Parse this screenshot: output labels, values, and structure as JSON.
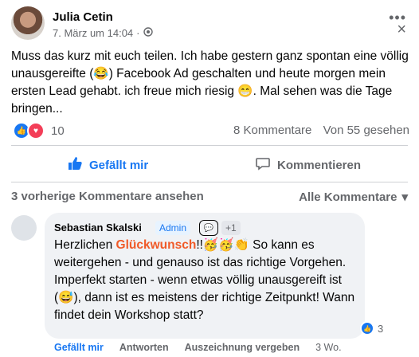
{
  "post": {
    "author": "Julia Cetin",
    "timestamp": "7. März um 14:04",
    "privacy_icon": "group-icon",
    "body": "Muss das kurz mit euch teilen. Ich habe gestern ganz spontan eine völlig unausgereifte (😂) Facebook Ad geschalten und heute morgen mein ersten Lead gehabt. ich freue mich riesig 😁. Mal sehen was die Tage bringen...",
    "reaction_count": "10",
    "comments_count": "8 Kommentare",
    "views": "Von 55 gesehen"
  },
  "actions": {
    "like": "Gefällt mir",
    "comment": "Kommentieren"
  },
  "comments": {
    "previous_label": "3 vorherige Kommentare ansehen",
    "filter_label": "Alle Kommentare"
  },
  "comment": {
    "author": "Sebastian Skalski",
    "role": "Admin",
    "extra_badges": "+1",
    "text_before": "Herzlichen ",
    "highlight": "Glückwunsch",
    "text_after": "!!🥳🥳👏 So kann es weitergehen - und genauso ist das richtige Vorgehen. Imperfekt starten - wenn etwas völlig unausgereift ist (😅), dann ist es meistens der richtige Zeitpunkt! Wann findet dein Workshop statt?",
    "reaction_count": "3",
    "like": "Gefällt mir",
    "reply": "Antworten",
    "award": "Auszeichnung vergeben",
    "time": "3 Wo."
  },
  "colors": {
    "accent": "#1877f2",
    "highlight": "#f05a28",
    "muted": "#65676b"
  }
}
